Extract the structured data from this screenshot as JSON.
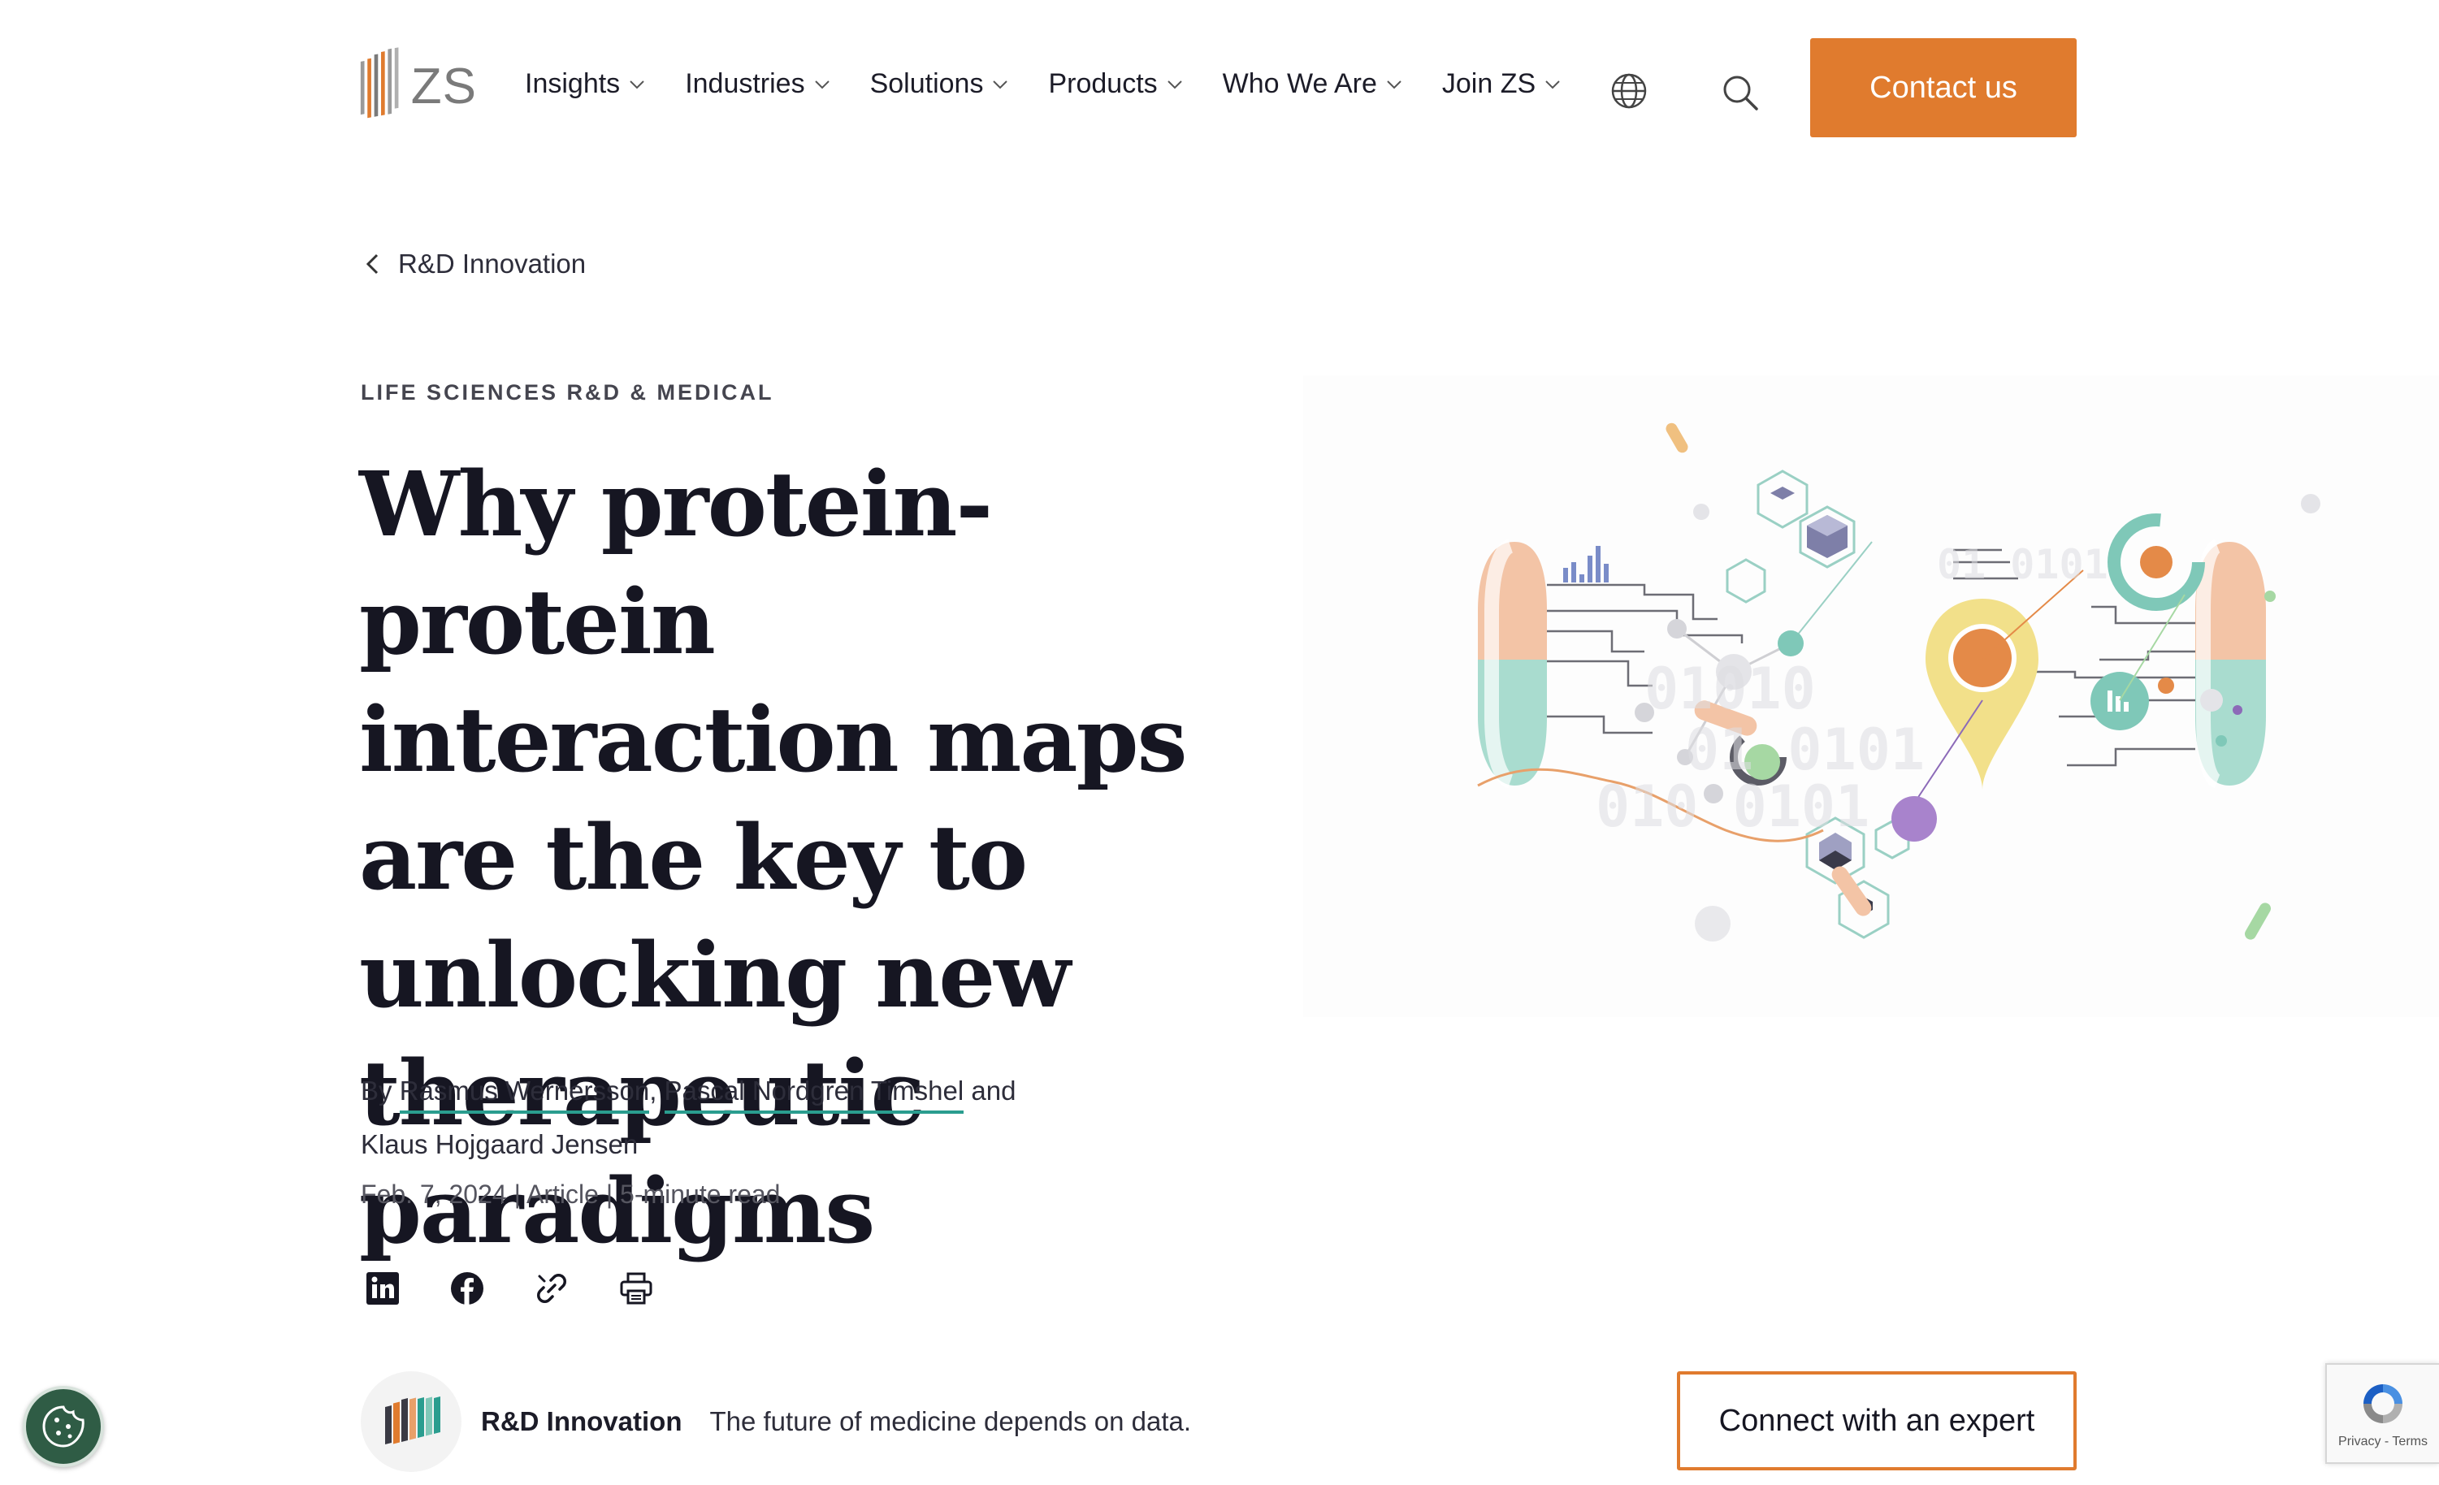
{
  "header": {
    "logo_text": "ZS",
    "nav": [
      {
        "label": "Insights"
      },
      {
        "label": "Industries"
      },
      {
        "label": "Solutions"
      },
      {
        "label": "Products"
      },
      {
        "label": "Who We Are"
      },
      {
        "label": "Join ZS"
      }
    ],
    "globe_icon": "globe-icon",
    "search_icon": "search-icon",
    "contact_label": "Contact us"
  },
  "breadcrumb": {
    "label": "R&D Innovation"
  },
  "article": {
    "eyebrow": "LIFE SCIENCES R&D & MEDICAL",
    "title": "Why protein-protein interaction maps are the key to unlocking new therapeutic paradigms",
    "by": "By",
    "authors": [
      "Rasmus Wernersson",
      "Pascal Nordgren Timshel",
      "Klaus Hojgaard Jensen"
    ],
    "and": "and",
    "date": "Feb. 7, 2024",
    "type": "Article",
    "read_time": "5-minute read",
    "separator": "|"
  },
  "share": [
    "linkedin-icon",
    "facebook-icon",
    "link-icon",
    "print-icon"
  ],
  "topic": {
    "name": "R&D Innovation",
    "tagline": "The future of medicine depends on data."
  },
  "expert_label": "Connect with an expert",
  "recaptcha": {
    "text": "Privacy - Terms"
  },
  "colors": {
    "accent": "#e07b2e",
    "link_underline": "#2a9d8f",
    "cookie": "#2f5c45"
  }
}
